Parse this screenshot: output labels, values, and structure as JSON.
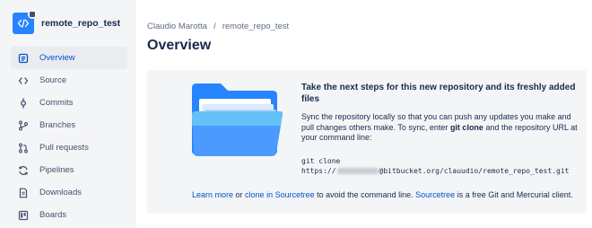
{
  "repo": {
    "name": "remote_repo_test",
    "icon": "code-icon",
    "accent": "#2684ff"
  },
  "sidebar": {
    "items": [
      {
        "label": "Overview",
        "icon": "overview-icon",
        "active": true
      },
      {
        "label": "Source",
        "icon": "source-icon"
      },
      {
        "label": "Commits",
        "icon": "commits-icon"
      },
      {
        "label": "Branches",
        "icon": "branches-icon"
      },
      {
        "label": "Pull requests",
        "icon": "pull-requests-icon"
      },
      {
        "label": "Pipelines",
        "icon": "pipelines-icon"
      },
      {
        "label": "Downloads",
        "icon": "downloads-icon"
      },
      {
        "label": "Boards",
        "icon": "boards-icon"
      }
    ]
  },
  "breadcrumb": {
    "owner": "Claudio Marotta",
    "separator": "/",
    "repo": "remote_repo_test"
  },
  "page": {
    "title": "Overview"
  },
  "panel": {
    "heading": "Take the next steps for this new repository and its freshly added files",
    "body_pre": "Sync the repository locally so that you can push any updates you make and pull changes others make. To sync, enter ",
    "body_bold": "git clone",
    "body_post": " and the repository URL at your command line:",
    "code_line1": "git clone",
    "code_prefix": "https://",
    "code_suffix": "@bitbucket.org/clauudio/remote_repo_test.git"
  },
  "footer": {
    "learn_more": "Learn more",
    "or": " or ",
    "clone_link": "clone in Sourcetree",
    "mid": " to avoid the command line. ",
    "sourcetree": "Sourcetree",
    "tail": " is a free Git and Mercurial client."
  },
  "colors": {
    "link": "#0052cc",
    "active_text": "#0052cc",
    "sidebar_bg": "#f4f5f7"
  }
}
